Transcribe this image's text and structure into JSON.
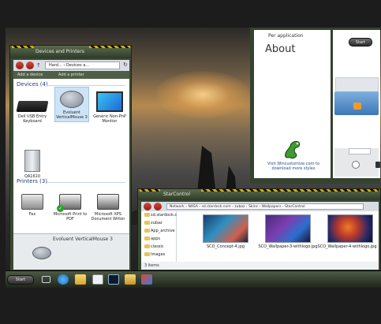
{
  "taskbar": {
    "start_label": "Start"
  },
  "devices_window": {
    "title": "Devices and Printers",
    "address": "Hard... › Devices a...",
    "toolbar": {
      "add_device": "Add a device",
      "add_printer": "Add a printer"
    },
    "groups": [
      {
        "title": "Devices (4)"
      },
      {
        "title": "Printers (3)"
      }
    ],
    "devices": [
      {
        "label": "Dell USB Entry Keyboard"
      },
      {
        "label": "Evoluent VerticalMouse 3"
      },
      {
        "label": "Generic Non-PnP Monitor"
      },
      {
        "label": "QA1610"
      }
    ],
    "printers": [
      {
        "label": "Fax"
      },
      {
        "label": "Microsoft Print to PDF"
      },
      {
        "label": "Microsoft XPS Document Writer"
      }
    ],
    "details_title": "Evoluent VerticalMouse 3"
  },
  "about_window": {
    "start_label": "Start",
    "per_application": "Per application",
    "heading": "About",
    "promo": "Visit Wincustomize.com to download more styles"
  },
  "starcontrol_window": {
    "title": "StarControl",
    "breadcrumb": "Network › NASA › sd.stardock.com › zubaz › Skins › Wallpapers › StarControl",
    "tree": [
      {
        "label": "sd.stardock.com"
      },
      {
        "label": "zubaz"
      },
      {
        "label": "App_archive"
      },
      {
        "label": "apps"
      },
      {
        "label": "classic"
      },
      {
        "label": "Images"
      }
    ],
    "files": [
      {
        "name": "SCO_Concept-4.jpg"
      },
      {
        "name": "SCO_Wallpaper-3-withlogo.jpg"
      },
      {
        "name": "SCO_Wallpaper-4-withlogo.jpg"
      }
    ],
    "status": "3 items"
  },
  "colors": {
    "frame": "#3a4a35",
    "hazard_yellow": "#d7b300",
    "group_heading": "#1f3d7a",
    "folder": "#e9c458"
  }
}
